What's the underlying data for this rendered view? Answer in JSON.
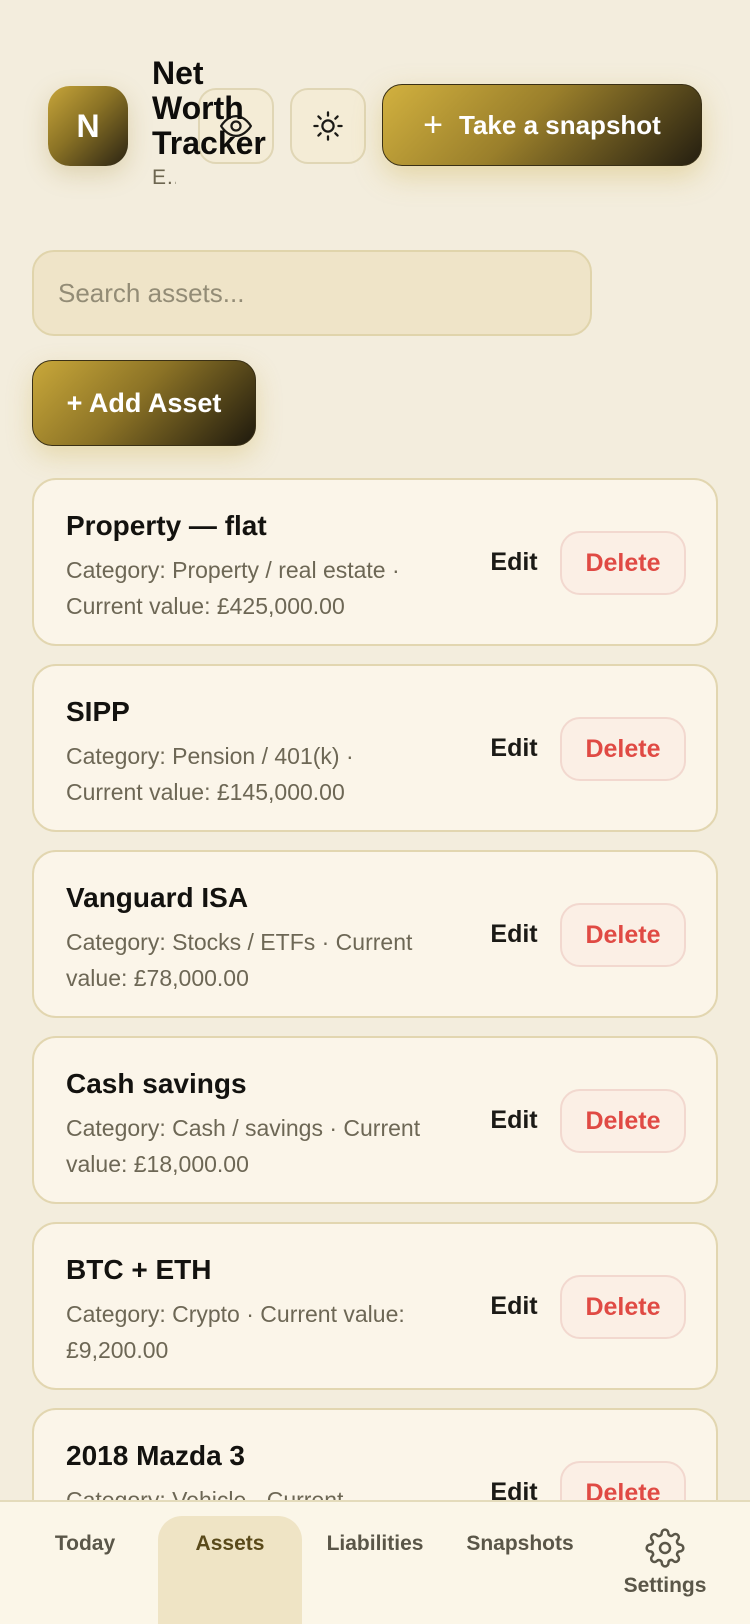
{
  "header": {
    "logo_letter": "N",
    "title": "Net Worth Tracker",
    "subtitle": "Everything you own, minus what you owe",
    "privacy_toggle_icon": "eye-icon",
    "theme_toggle_icon": "sun-icon",
    "snapshot_button_label": "Take a snapshot"
  },
  "search": {
    "placeholder": "Search assets...",
    "value": ""
  },
  "add_asset_label": "+ Add Asset",
  "assets": [
    {
      "name": "Property — flat",
      "meta": "Category: Property / real estate · Current value: £425,000.00",
      "edit_label": "Edit",
      "delete_label": "Delete"
    },
    {
      "name": "SIPP",
      "meta": "Category: Pension / 401(k) · Current value: £145,000.00",
      "edit_label": "Edit",
      "delete_label": "Delete"
    },
    {
      "name": "Vanguard ISA",
      "meta": "Category: Stocks / ETFs · Current value: £78,000.00",
      "edit_label": "Edit",
      "delete_label": "Delete"
    },
    {
      "name": "Cash savings",
      "meta": "Category: Cash / savings · Current value: £18,000.00",
      "edit_label": "Edit",
      "delete_label": "Delete"
    },
    {
      "name": "BTC + ETH",
      "meta": "Category: Crypto · Current value: £9,200.00",
      "edit_label": "Edit",
      "delete_label": "Delete"
    },
    {
      "name": "2018 Mazda 3",
      "meta": "Category: Vehicle · Current",
      "edit_label": "Edit",
      "delete_label": "Delete"
    }
  ],
  "nav": {
    "today": "Today",
    "assets": "Assets",
    "liabilities": "Liabilities",
    "snapshots": "Snapshots",
    "settings": "Settings",
    "active": "Assets"
  },
  "colors": {
    "background": "#f3eddd",
    "accent_gold": "#c7a53a",
    "delete_red": "#e04a44"
  }
}
